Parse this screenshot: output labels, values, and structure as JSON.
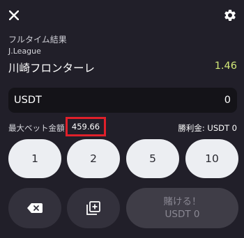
{
  "header": {
    "close_icon": "close-icon",
    "settings_icon": "gear-icon"
  },
  "bet": {
    "market": "フルタイム結果",
    "league": "J.League",
    "selection": "川崎フロンターレ",
    "odds": "1.46"
  },
  "amount": {
    "currency": "USDT",
    "value": "0"
  },
  "limits": {
    "max_bet_label": "最大ベット金額",
    "max_bet_value": "459.66",
    "winnings_label": "勝利金: USDT 0"
  },
  "quick_amounts": [
    "1",
    "2",
    "5",
    "10"
  ],
  "actions": {
    "backspace_icon": "backspace-icon",
    "copy_icon": "copy-add-icon",
    "bet_label": "賭ける！",
    "bet_amount": "USDT 0"
  },
  "colors": {
    "background": "#211f29",
    "odds": "#d2e978",
    "highlight_border": "#e0202a"
  }
}
